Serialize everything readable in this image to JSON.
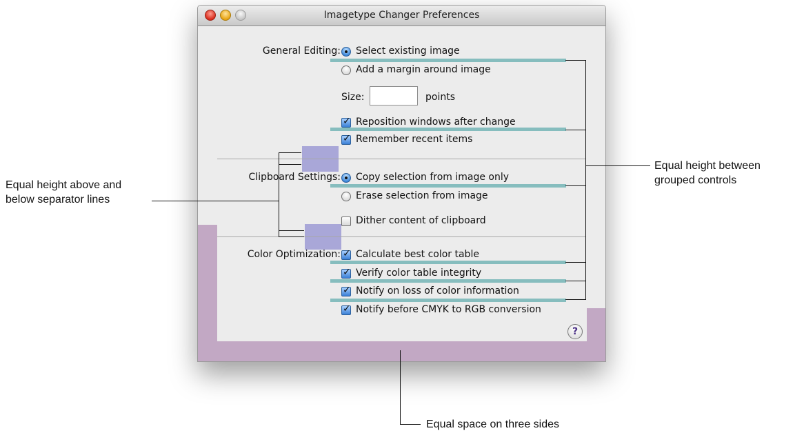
{
  "window": {
    "title": "Imagetype Changer Preferences"
  },
  "general_editing": {
    "label": "General Editing:",
    "options": [
      {
        "label": "Select existing image",
        "selected": true
      },
      {
        "label": "Add a margin around image",
        "selected": false
      }
    ],
    "size_label": "Size:",
    "size_value": "",
    "size_unit": "points",
    "checkboxes": [
      {
        "label": "Reposition windows after change",
        "checked": true
      },
      {
        "label": "Remember recent items",
        "checked": true
      }
    ]
  },
  "clipboard_settings": {
    "label": "Clipboard Settings:",
    "options": [
      {
        "label": "Copy selection from image only",
        "selected": true
      },
      {
        "label": "Erase selection from image",
        "selected": false
      }
    ],
    "checkbox": {
      "label": "Dither content of clipboard",
      "checked": false
    }
  },
  "color_optimization": {
    "label": "Color Optimization:",
    "checkboxes": [
      {
        "label": "Calculate best color table",
        "checked": true
      },
      {
        "label": "Verify color table integrity",
        "checked": true
      },
      {
        "label": "Notify on loss of color information",
        "checked": true
      },
      {
        "label": "Notify before CMYK to RGB conversion",
        "checked": true
      }
    ]
  },
  "help_button": {
    "glyph": "?"
  },
  "annotations": {
    "separator_note_line1": "Equal height above and",
    "separator_note_line2": "below separator lines",
    "grouped_note_line1": "Equal height between",
    "grouped_note_line2": "grouped controls",
    "space_note": "Equal space on three sides"
  },
  "colors": {
    "spacing_guide_teal": "#86bdbe",
    "separator_guide_purple": "#a9a7d8",
    "margin_guide_mauve": "#c2a8c4"
  }
}
